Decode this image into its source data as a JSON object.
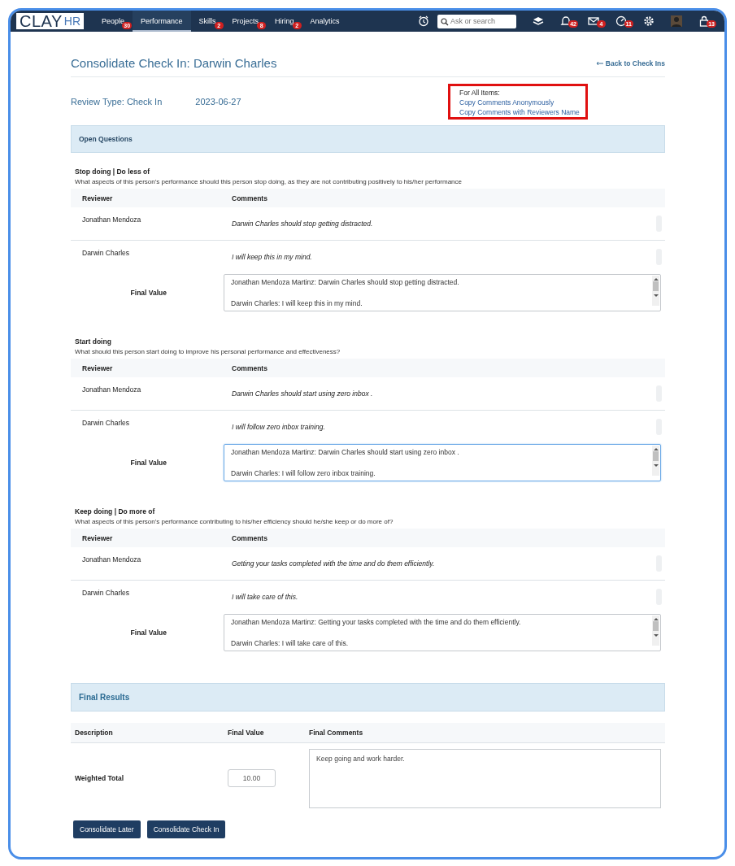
{
  "nav": {
    "logo_main": "CLAY",
    "logo_sub": "HR",
    "items": [
      {
        "label": "People",
        "badge": "30",
        "selected": false
      },
      {
        "label": "Performance",
        "selected": true
      },
      {
        "label": "Skills",
        "badge": "2",
        "selected": false
      },
      {
        "label": "Projects",
        "badge": "8",
        "selected": false
      },
      {
        "label": "Hiring",
        "badge": "2",
        "selected": false
      },
      {
        "label": "Analytics",
        "selected": false
      }
    ],
    "search": {
      "placeholder": "Ask or search"
    },
    "icons": [
      {
        "kind": "layers"
      },
      {
        "kind": "bell",
        "badge": "42"
      },
      {
        "kind": "mail",
        "badge": "4"
      },
      {
        "kind": "gauge",
        "badge": "11"
      },
      {
        "kind": "gear"
      },
      {
        "kind": "avatar"
      },
      {
        "kind": "lock",
        "badge": "13"
      }
    ]
  },
  "page": {
    "title": "Consolidate Check In: Darwin Charles",
    "back_link": "Back to Check Ins",
    "review_type": "Review Type: Check In",
    "date": "2023-06-27",
    "copy_box": {
      "heading": "For All Items:",
      "links": [
        "Copy Comments Anonymously",
        "Copy Comments with Reviewers Name"
      ]
    }
  },
  "open_questions": {
    "heading": "Open Questions",
    "questions": [
      {
        "columns": [
          "Reviewer",
          "Comments"
        ],
        "final_label": "Final Value",
        "title": "Stop doing | Do less of",
        "description": "What aspects of this person's performance should this person stop doing, as they are not contributing positively to his/her performance",
        "rows": [
          {
            "reviewer": "Jonathan Mendoza",
            "comment": "Darwin Charles should stop getting distracted."
          },
          {
            "reviewer": "Darwin Charles",
            "comment": "I will keep this in my mind."
          }
        ],
        "final_lines": [
          "Jonathan Mendoza Martinz: Darwin Charles should stop getting distracted.",
          "Darwin Charles: I will keep this in my mind."
        ],
        "focused": false
      },
      {
        "columns": [
          "Reviewer",
          "Comments"
        ],
        "final_label": "Final Value",
        "title": "Start doing",
        "description": "What should this person start doing to improve his personal performance and effectiveness?",
        "rows": [
          {
            "reviewer": "Jonathan Mendoza",
            "comment": "Darwin Charles should start using zero inbox ."
          },
          {
            "reviewer": "Darwin Charles",
            "comment": "I will follow zero inbox training."
          }
        ],
        "final_lines": [
          "Jonathan Mendoza Martinz: Darwin Charles should start using zero inbox .",
          "Darwin Charles: I will follow zero inbox training."
        ],
        "focused": true
      },
      {
        "columns": [
          "Reviewer",
          "Comments"
        ],
        "final_label": "Final Value",
        "title": "Keep doing | Do more of",
        "description": "What aspects of this person's performance contributing to his/her efficiency should he/she keep or do more of?",
        "rows": [
          {
            "reviewer": "Jonathan Mendoza",
            "comment": "Getting your tasks completed with the time and do them efficiently."
          },
          {
            "reviewer": "Darwin Charles",
            "comment": "I will take care of this."
          }
        ],
        "final_lines": [
          "Jonathan Mendoza Martinz: Getting your tasks completed with the time and do them efficiently.",
          "Darwin Charles: I will take care of this."
        ],
        "focused": false
      }
    ]
  },
  "final_results": {
    "heading": "Final Results",
    "columns": [
      "Description",
      "Final Value",
      "Final Comments"
    ],
    "row": {
      "description": "Weighted Total",
      "value": "10.00",
      "comments": "Keep going and work harder."
    }
  },
  "buttons": [
    "Consolidate Later",
    "Consolidate Check In"
  ]
}
